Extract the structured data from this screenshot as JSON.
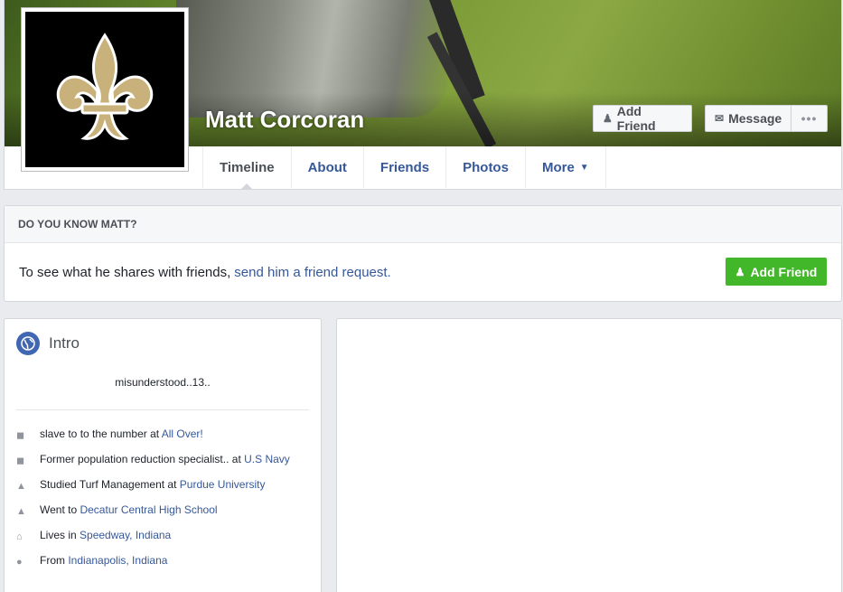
{
  "profile": {
    "name": "Matt Corcoran"
  },
  "cover_buttons": {
    "add_friend": "Add Friend",
    "message": "Message",
    "more": "•••"
  },
  "tabs": [
    {
      "label": "Timeline",
      "active": true
    },
    {
      "label": "About"
    },
    {
      "label": "Friends"
    },
    {
      "label": "Photos"
    },
    {
      "label": "More"
    }
  ],
  "know_card": {
    "heading": "DO YOU KNOW MATT?",
    "text": "To see what he shares with friends,",
    "link": "send him a friend request.",
    "button": "Add Friend"
  },
  "intro": {
    "title": "Intro",
    "bio": "misunderstood..13..",
    "items": [
      {
        "icon": "briefcase-icon",
        "prefix": "slave to to the number at ",
        "link": "All Over!"
      },
      {
        "icon": "briefcase-icon",
        "prefix": "Former population reduction specialist.. at ",
        "link": "U.S Navy"
      },
      {
        "icon": "graduation-cap-icon",
        "prefix": "Studied Turf Management at ",
        "link": "Purdue University"
      },
      {
        "icon": "graduation-cap-icon",
        "prefix": "Went to ",
        "link": "Decatur Central High School"
      },
      {
        "icon": "home-icon",
        "prefix": "Lives in ",
        "link": "Speedway, Indiana"
      },
      {
        "icon": "map-pin-icon",
        "prefix": "From ",
        "link": "Indianapolis, Indiana"
      }
    ]
  },
  "colors": {
    "link": "#365899",
    "green": "#42b72a",
    "background": "#e9ebee"
  }
}
